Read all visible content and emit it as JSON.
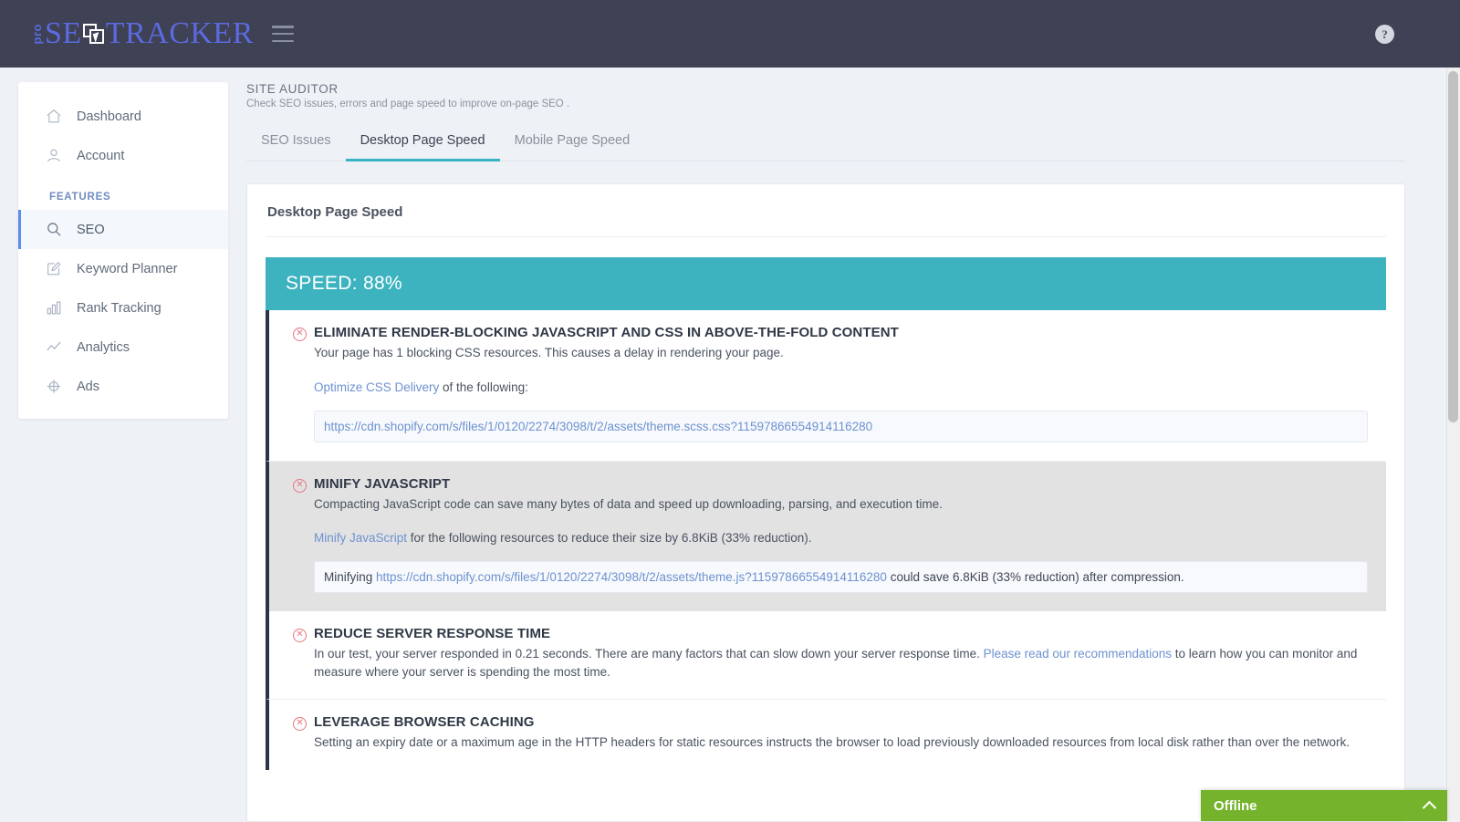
{
  "topbar": {
    "logo_pro": "pro",
    "logo_seo": "SE",
    "logo_tracker": "TRACKER",
    "logo_icon_name": "window-cursor-icon",
    "menu_icon": "hamburger-icon",
    "help_icon_glyph": "?"
  },
  "sidebar": {
    "items": [
      {
        "label": "Dashboard",
        "icon": "home-icon",
        "active": false
      },
      {
        "label": "Account",
        "icon": "user-icon",
        "active": false
      }
    ],
    "section_label": "FEATURES",
    "features": [
      {
        "label": "SEO",
        "icon": "search-icon",
        "active": true
      },
      {
        "label": "Keyword Planner",
        "icon": "pencil-square-icon",
        "active": false
      },
      {
        "label": "Rank Tracking",
        "icon": "bar-chart-icon",
        "active": false
      },
      {
        "label": "Analytics",
        "icon": "line-chart-icon",
        "active": false
      },
      {
        "label": "Ads",
        "icon": "target-icon",
        "active": false
      }
    ]
  },
  "page": {
    "title": "SITE AUDITOR",
    "subtitle": "Check SEO issues, errors and page speed to improve on-page SEO .",
    "tabs": [
      {
        "label": "SEO Issues",
        "active": false
      },
      {
        "label": "Desktop Page Speed",
        "active": true
      },
      {
        "label": "Mobile Page Speed",
        "active": false
      }
    ],
    "card_title": "Desktop Page Speed",
    "speed_banner": "SPEED: 88%",
    "speed_value": 88,
    "accent_teal": "#3eb3c0",
    "accent_navy": "#2c3446",
    "accent_blue": "#5b6ae0"
  },
  "issues": [
    {
      "title": "ELIMINATE RENDER-BLOCKING JAVASCRIPT AND CSS IN ABOVE-THE-FOLD CONTENT",
      "description": "Your page has 1 blocking CSS resources. This causes a delay in rendering your page.",
      "action_link": "Optimize CSS Delivery",
      "action_rest": " of the following:",
      "code_prefix": "",
      "code_link": "https://cdn.shopify.com/s/files/1/0120/2274/3098/t/2/assets/theme.scss.css?11597866554914116280",
      "code_suffix": ""
    },
    {
      "title": "MINIFY JAVASCRIPT",
      "description": "Compacting JavaScript code can save many bytes of data and speed up downloading, parsing, and execution time.",
      "action_link": "Minify JavaScript",
      "action_rest": " for the following resources to reduce their size by 6.8KiB (33% reduction).",
      "code_prefix": "Minifying ",
      "code_link": "https://cdn.shopify.com/s/files/1/0120/2274/3098/t/2/assets/theme.js?11597866554914116280",
      "code_suffix": " could save 6.8KiB (33% reduction) after compression."
    },
    {
      "title": "REDUCE SERVER RESPONSE TIME",
      "description_before": "In our test, your server responded in 0.21 seconds. There are many factors that can slow down your server response time. ",
      "description_link": "Please read our recommendations",
      "description_after": " to learn how you can monitor and measure where your server is spending the most time."
    },
    {
      "title": "LEVERAGE BROWSER CACHING",
      "description": "Setting an expiry date or a maximum age in the HTTP headers for static resources instructs the browser to load previously downloaded resources from local disk rather than over the network."
    }
  ],
  "chat_widget": {
    "status_label": "Offline",
    "chevron_icon": "chevron-up-icon",
    "color": "#74b32b"
  }
}
